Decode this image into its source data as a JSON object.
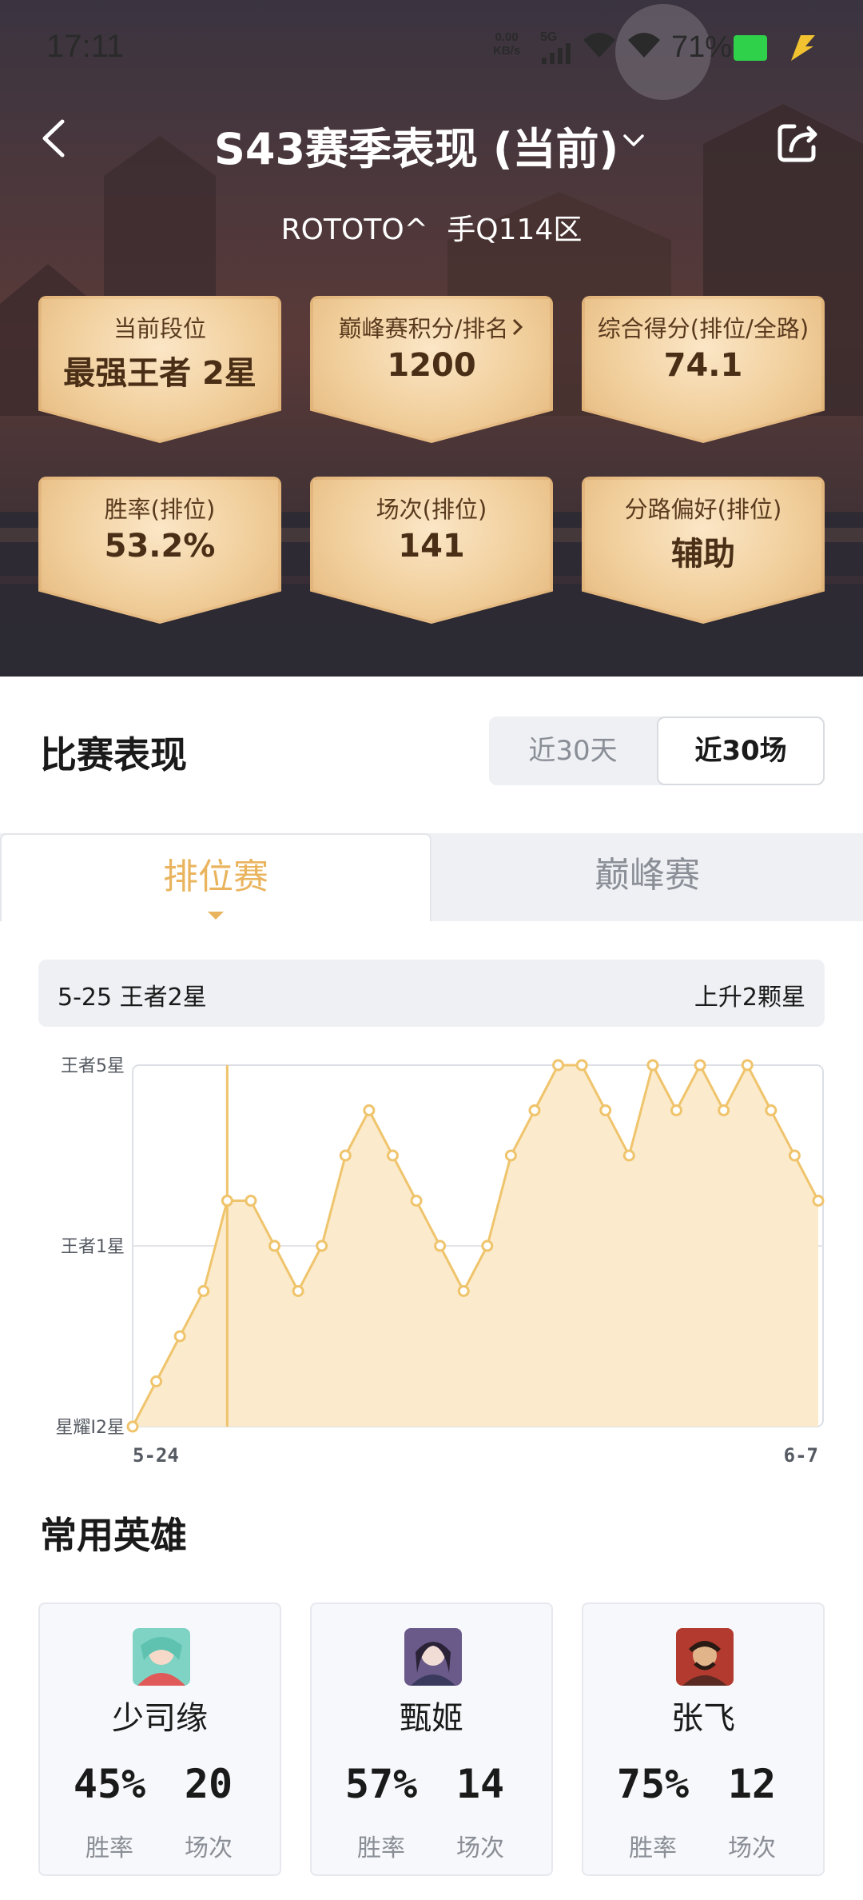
{
  "status_bar": {
    "time": "17:11",
    "net_speed_value": "0.00",
    "net_speed_unit": "KB/s",
    "network": "5G",
    "battery": "71%"
  },
  "header": {
    "title": "S43赛季表现 (当前)",
    "player_name": "ROTOTO^",
    "server": "手Q114区"
  },
  "stats": [
    {
      "label": "当前段位",
      "value": "最强王者 2星"
    },
    {
      "label": "巅峰赛积分/排名",
      "value": "1200"
    },
    {
      "label": "综合得分(排位/全路)",
      "value": "74.1"
    },
    {
      "label": "胜率(排位)",
      "value": "53.2%"
    },
    {
      "label": "场次(排位)",
      "value": "141"
    },
    {
      "label": "分路偏好(排位)",
      "value": "辅助"
    }
  ],
  "performance": {
    "title": "比赛表现",
    "range_options": [
      "近30天",
      "近30场"
    ],
    "range_selected": "近30场",
    "tabs": [
      "排位赛",
      "巅峰赛"
    ],
    "tab_selected": "排位赛",
    "info_left": "5-25 王者2星",
    "info_right": "上升2颗星"
  },
  "chart_data": {
    "type": "area",
    "y_tick_labels": [
      "星耀I2星",
      "王者1星",
      "王者5星"
    ],
    "y_tick_values": [
      0,
      4,
      8
    ],
    "ylim": [
      0,
      8
    ],
    "x_start_label": "5-24",
    "x_end_label": "6-7",
    "values": [
      0,
      1,
      2,
      3,
      5,
      5,
      4,
      3,
      4,
      6,
      7,
      6,
      5,
      4,
      3,
      4,
      6,
      7,
      8,
      8,
      7,
      6,
      8,
      7,
      8,
      7,
      8,
      7,
      6,
      5
    ],
    "highlight_index": 4,
    "color": "#efc46c",
    "fill": "#fbebcc"
  },
  "heroes_section": {
    "title": "常用英雄",
    "heroes": [
      {
        "name": "少司缘",
        "win_rate": "45%",
        "games": "20",
        "win_rate_label": "胜率",
        "games_label": "场次",
        "avatar_color": "#7fd3c4"
      },
      {
        "name": "甄姬",
        "win_rate": "57%",
        "games": "14",
        "win_rate_label": "胜率",
        "games_label": "场次",
        "avatar_color": "#6a5a8a"
      },
      {
        "name": "张飞",
        "win_rate": "75%",
        "games": "12",
        "win_rate_label": "胜率",
        "games_label": "场次",
        "avatar_color": "#b23a2e"
      }
    ]
  }
}
